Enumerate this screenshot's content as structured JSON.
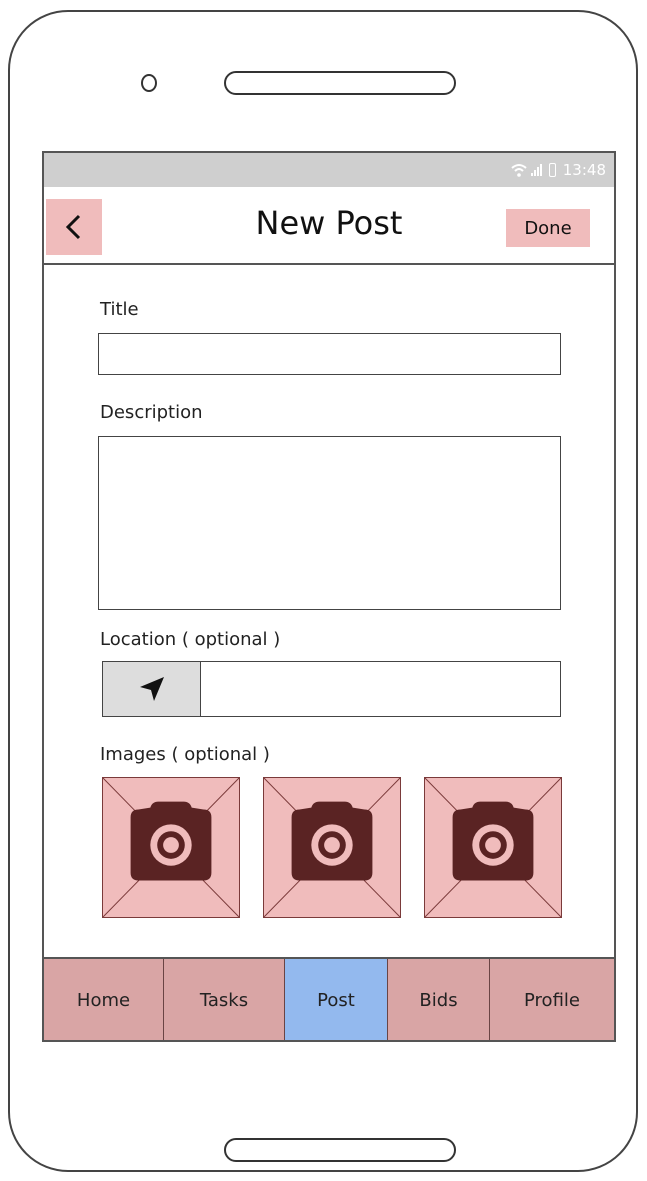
{
  "status_bar": {
    "time": "13:48"
  },
  "header": {
    "back_icon": "chevron-left-icon",
    "title": "New Post",
    "done_label": "Done"
  },
  "form": {
    "title_label": "Title",
    "title_value": "",
    "description_label": "Description",
    "description_value": "",
    "location_label": "Location ( optional )",
    "location_icon": "navigation-arrow-icon",
    "location_value": "",
    "images_label": "Images ( optional )",
    "image_slot_icon": "camera-icon"
  },
  "tabs": [
    {
      "label": "Home",
      "active": false
    },
    {
      "label": "Tasks",
      "active": false
    },
    {
      "label": "Post",
      "active": true
    },
    {
      "label": "Bids",
      "active": false
    },
    {
      "label": "Profile",
      "active": false
    }
  ],
  "colors": {
    "accent_pink": "#f0bcbc",
    "tab_bg": "#d9a5a5",
    "tab_active": "#93b9ee",
    "camera_dark": "#5a2323"
  }
}
